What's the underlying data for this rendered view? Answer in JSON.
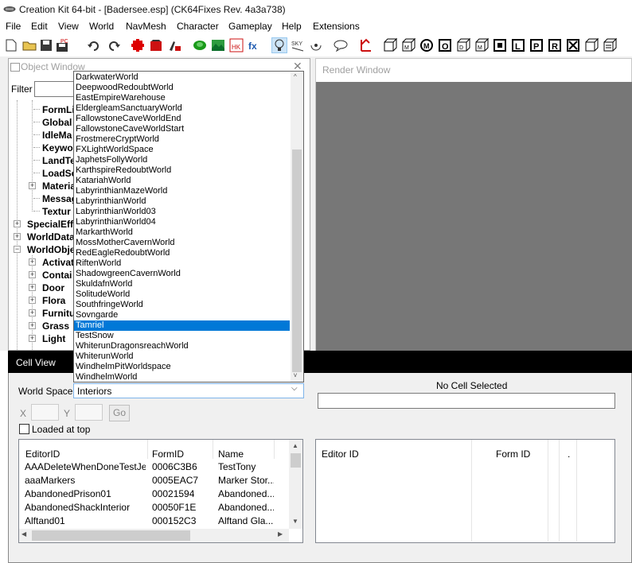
{
  "window": {
    "title": "Creation Kit 64-bit - [Badersee.esp] (CK64Fixes Rev. 4a3a738)"
  },
  "menu": [
    "File",
    "Edit",
    "View",
    "World",
    "NavMesh",
    "Character",
    "Gameplay",
    "Help",
    "Extensions"
  ],
  "toolbar_icons": [
    "new-icon",
    "open-icon",
    "save-icon",
    "pc-save-icon",
    "undo-icon",
    "redo-icon",
    "preferences-icon",
    "render-icon",
    "landscape-icon",
    "brush-icon",
    "map-icon",
    "navmesh-icon",
    "hk-icon",
    "fx-icon",
    "light-bulb-icon",
    "sky-icon",
    "wind-icon",
    "speech-icon",
    "marker-icon",
    "cube-icon",
    "cube-m-icon",
    "cube-s-icon",
    "cube-m2-icon",
    "cube-o-icon",
    "cube-d-icon",
    "cube-p-icon",
    "cube-r-icon",
    "cube-l-icon",
    "cube-x-icon",
    "cube-grid-icon"
  ],
  "object_window": {
    "title": "Object Window",
    "filter_label": "Filter",
    "tree": [
      {
        "label": "FormLi"
      },
      {
        "label": "Global"
      },
      {
        "label": "IdleMa"
      },
      {
        "label": "Keywo"
      },
      {
        "label": "LandTe"
      },
      {
        "label": "LoadSc"
      },
      {
        "label": "Materia"
      },
      {
        "label": "Messag"
      },
      {
        "label": "Textur"
      },
      {
        "label": "SpecialEff"
      },
      {
        "label": "WorldData"
      },
      {
        "label": "WorldObje"
      },
      {
        "label": "Activat"
      },
      {
        "label": "Contai"
      },
      {
        "label": "Door"
      },
      {
        "label": "Flora"
      },
      {
        "label": "Furnitu"
      },
      {
        "label": "Grass"
      },
      {
        "label": "Light"
      }
    ]
  },
  "render_window": {
    "title": "Render Window"
  },
  "cell_view": {
    "title": "Cell View",
    "world_space_label": "World Space",
    "world_space_value": "Interiors",
    "no_cell_text": "No Cell Selected",
    "x_label": "X",
    "y_label": "Y",
    "go_label": "Go",
    "loaded_at_top_label": "Loaded at top",
    "cell_list": {
      "columns": [
        "EditorID",
        "FormID",
        "Name"
      ],
      "rows": [
        [
          "AAADeleteWhenDoneTestJer...",
          "0006C3B6",
          "TestTony"
        ],
        [
          "aaaMarkers",
          "0005EAC7",
          "Marker Stor..."
        ],
        [
          "AbandonedPrison01",
          "00021594",
          "Abandoned..."
        ],
        [
          "AbandonedShackInterior",
          "00050F1E",
          "Abandoned..."
        ],
        [
          "Alftand01",
          "000152C3",
          "Alftand Gla..."
        ]
      ]
    },
    "ref_list": {
      "columns": [
        "Editor ID",
        "Form ID",
        "."
      ]
    }
  },
  "dropdown": {
    "selected": "Tamriel",
    "items": [
      "DarkwaterWorld",
      "DeepwoodRedoubtWorld",
      "EastEmpireWarehouse",
      "EldergleamSanctuaryWorld",
      "FallowstoneCaveWorldEnd",
      "FallowstoneCaveWorldStart",
      "FrostmereCryptWorld",
      "FXLightWorldSpace",
      "JaphetsFollyWorld",
      "KarthspireRedoubtWorld",
      "KatariahWorld",
      "LabyrinthianMazeWorld",
      "LabyrinthianWorld",
      "LabyrinthianWorld03",
      "LabyrinthianWorld04",
      "MarkarthWorld",
      "MossMotherCavernWorld",
      "RedEagleRedoubtWorld",
      "RiftenWorld",
      "ShadowgreenCavernWorld",
      "SkuldafnWorld",
      "SolitudeWorld",
      "SouthfringeWorld",
      "Sovngarde",
      "Tamriel",
      "TestSnow",
      "WhiterunDragonsreachWorld",
      "WhiterunWorld",
      "WindhelmPitWorldspace",
      "WindhelmWorld"
    ]
  }
}
